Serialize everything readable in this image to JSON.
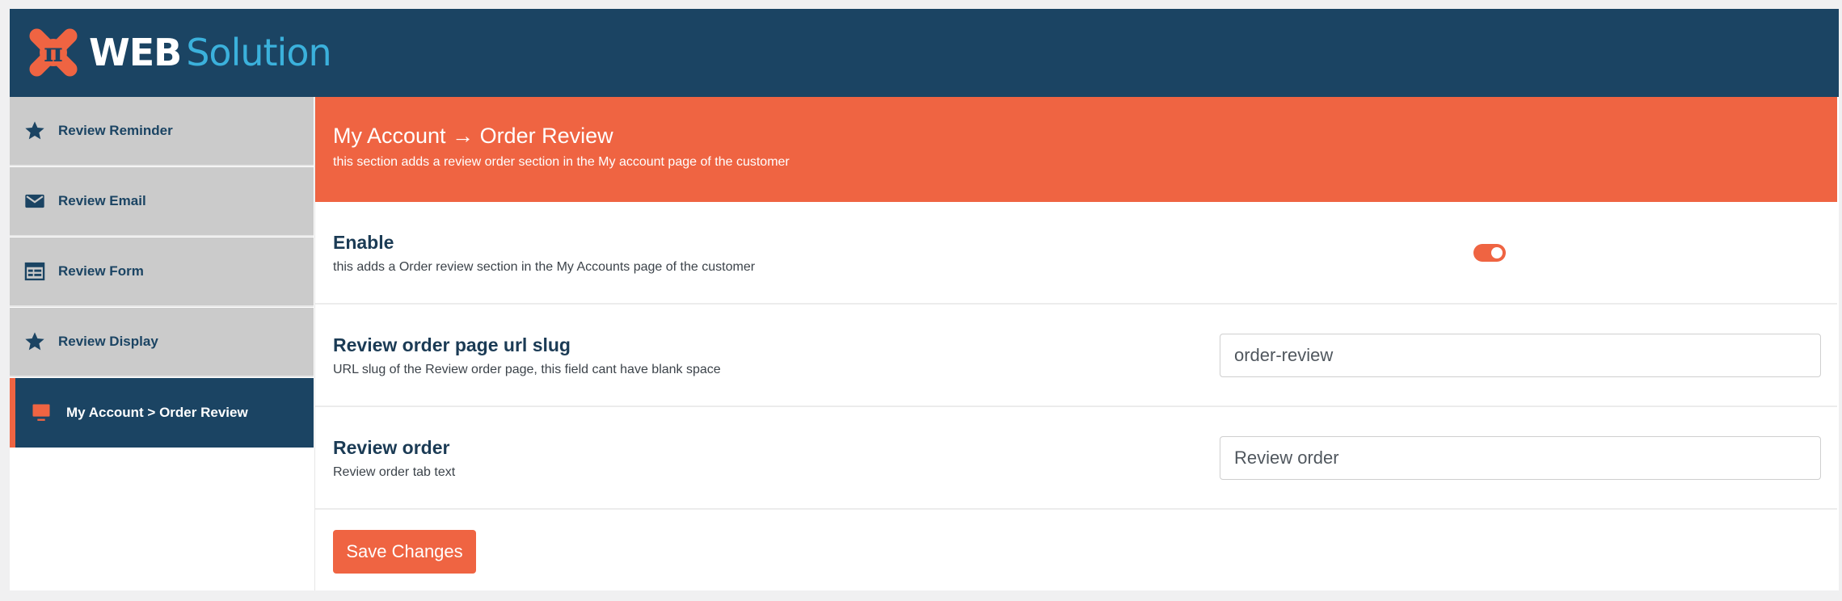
{
  "brand": {
    "logo_glyph": "π",
    "name_part1": "WEB",
    "name_part2": "Solution",
    "colors": {
      "navy": "#1b4463",
      "orange": "#ef6442",
      "light_blue": "#3bb1dc"
    }
  },
  "sidebar": {
    "items": [
      {
        "label": "Review Reminder",
        "icon": "star-icon",
        "active": false
      },
      {
        "label": "Review Email",
        "icon": "envelope-icon",
        "active": false
      },
      {
        "label": "Review Form",
        "icon": "form-icon",
        "active": false
      },
      {
        "label": "Review Display",
        "icon": "star-icon",
        "active": false
      },
      {
        "label": "My Account > Order Review",
        "icon": "monitor-icon",
        "active": true
      }
    ]
  },
  "main": {
    "title": "My Account → Order Review",
    "subtitle": "this section adds a review order section in the My account page of the customer",
    "settings": {
      "enable": {
        "title": "Enable",
        "description": "this adds a Order review section in the My Accounts page of the customer",
        "enabled": true
      },
      "slug": {
        "title": "Review order page url slug",
        "description": "URL slug of the Review order page, this field cant have blank space",
        "value": "order-review"
      },
      "tab_text": {
        "title": "Review order",
        "description": "Review order tab text",
        "value": "Review order"
      }
    },
    "save_label": "Save Changes"
  }
}
